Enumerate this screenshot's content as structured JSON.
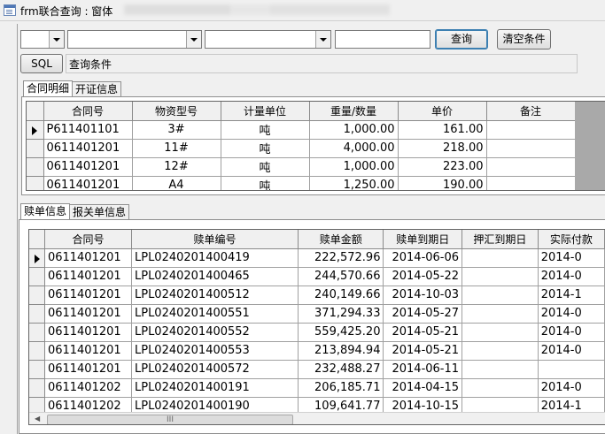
{
  "window": {
    "title": "frm联合查询 : 窗体"
  },
  "toolbar": {
    "query_label": "查询",
    "clear_label": "清空条件",
    "sql_label": "SQL",
    "condition_text": "查询条件"
  },
  "tabs_top": [
    {
      "label": "合同明细",
      "active": true
    },
    {
      "label": "开证信息",
      "active": false
    }
  ],
  "contract_grid": {
    "columns": [
      "合同号",
      "物资型号",
      "计量单位",
      "重量/数量",
      "单价",
      "备注"
    ],
    "rows": [
      [
        "P611401101",
        "3#",
        "吨",
        "1,000.00",
        "161.00",
        ""
      ],
      [
        "0611401201",
        "11#",
        "吨",
        "4,000.00",
        "218.00",
        ""
      ],
      [
        "0611401201",
        "12#",
        "吨",
        "1,000.00",
        "223.00",
        ""
      ],
      [
        "0611401201",
        "A4",
        "吨",
        "1,250.00",
        "190.00",
        ""
      ]
    ]
  },
  "tabs_bottom": [
    {
      "label": "赎单信息",
      "active": true
    },
    {
      "label": "报关单信息",
      "active": false
    }
  ],
  "redeem_grid": {
    "columns": [
      "合同号",
      "赎单编号",
      "赎单金额",
      "赎单到期日",
      "押汇到期日",
      "实际付款"
    ],
    "rows": [
      [
        "0611401201",
        "LPL0240201400419",
        "222,572.96",
        "2014-06-06",
        "",
        "2014-0"
      ],
      [
        "0611401201",
        "LPL0240201400465",
        "244,570.66",
        "2014-05-22",
        "",
        "2014-0"
      ],
      [
        "0611401201",
        "LPL0240201400512",
        "240,149.66",
        "2014-10-03",
        "",
        "2014-1"
      ],
      [
        "0611401201",
        "LPL0240201400551",
        "371,294.33",
        "2014-05-27",
        "",
        "2014-0"
      ],
      [
        "0611401201",
        "LPL0240201400552",
        "559,425.20",
        "2014-05-21",
        "",
        "2014-0"
      ],
      [
        "0611401201",
        "LPL0240201400553",
        "213,894.94",
        "2014-05-21",
        "",
        "2014-0"
      ],
      [
        "0611401201",
        "LPL0240201400572",
        "232,488.27",
        "2014-06-11",
        "",
        ""
      ],
      [
        "0611401202",
        "LPL0240201400191",
        "206,185.71",
        "2014-04-15",
        "",
        "2014-0"
      ],
      [
        "0611401202",
        "LPL0240201400190",
        "109,641.77",
        "2014-10-15",
        "",
        "2014-1"
      ]
    ]
  },
  "scroll_thumb_glyph": "III"
}
